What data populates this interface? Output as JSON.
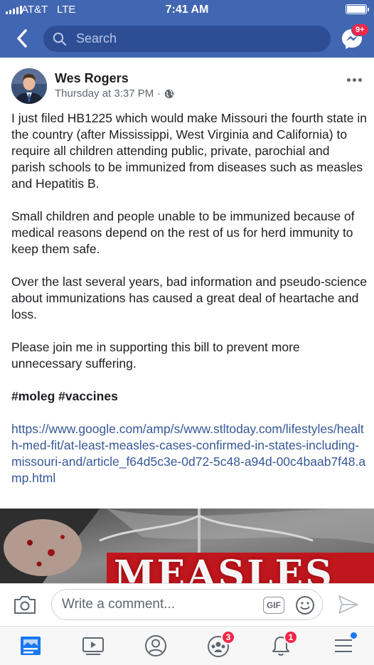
{
  "status_bar": {
    "carrier": "AT&T",
    "network": "LTE",
    "time": "7:41 AM"
  },
  "search": {
    "placeholder": "Search"
  },
  "messenger": {
    "badge": "9+"
  },
  "post": {
    "author": "Wes Rogers",
    "timestamp": "Thursday at 3:37 PM",
    "separator": "·",
    "audience_icon": "globe-icon",
    "paragraphs": [
      "I just filed HB1225 which would make Missouri the fourth state in the country (after Mississippi, West Virginia and California) to require all children attending public, private, parochial and parish schools to be immunized from diseases such as measles and Hepatitis B.",
      "Small children and people unable to be immunized because of medical reasons depend on the rest of us for herd immunity to keep them safe.",
      "Over the last several years, bad information and pseudo-science about immunizations has caused a great deal of heartache and loss.",
      "Please join me in supporting this bill to prevent more unnecessary suffering."
    ],
    "hashtags": "#moleg #vaccines",
    "link": "https://www.google.com/amp/s/www.stltoday.com/lifestyles/health-med-fit/at-least-measles-cases-confirmed-in-states-including-missouri-and/article_f64d5c3e-0d72-5c48-a94d-00c4baab7f48.amp.html",
    "preview_title": "MEASLES"
  },
  "comment": {
    "placeholder": "Write a comment...",
    "gif_label": "GIF"
  },
  "tabs": {
    "groups_badge": "3",
    "notifications_badge": "1"
  },
  "colors": {
    "brand": "#4267b2",
    "link": "#385898",
    "badge": "#f02849"
  }
}
